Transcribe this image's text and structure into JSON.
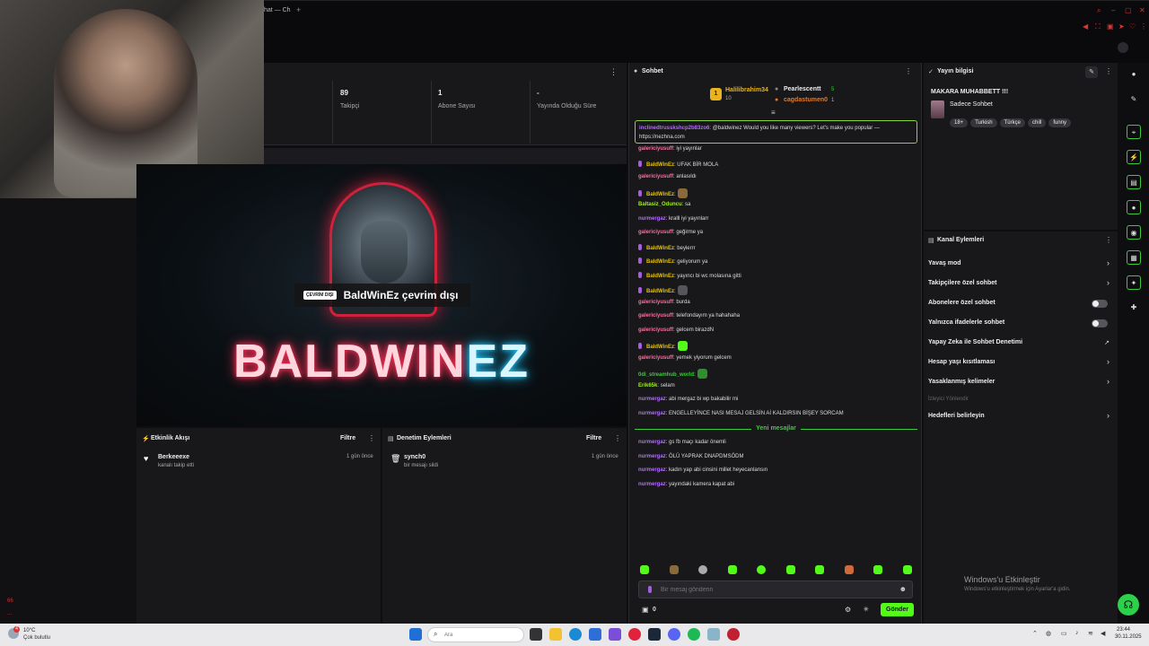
{
  "browser": {
    "tab_title": "hat — Ch",
    "new_tab": "+"
  },
  "stats": {
    "followers_value": "89",
    "followers_label": "Takipçi",
    "subs_value": "1",
    "subs_label": "Abone Sayısı",
    "live_value": "-",
    "live_label": "Yayında Olduğu Süre"
  },
  "video": {
    "offline_badge": "ÇEVRİM DIŞI",
    "offline_text": "BaldWinEz çevrim dışı",
    "brand_part1": "BALDWIN",
    "brand_part2": "EZ"
  },
  "activity": {
    "title": "Etkinlik Akışı",
    "filter": "Filtre",
    "items": [
      {
        "name": "Berkeeexe",
        "desc": "kanalı takip etti",
        "time": "1 gün önce"
      }
    ]
  },
  "moderation": {
    "title": "Denetim Eylemleri",
    "filter": "Filtre",
    "items": [
      {
        "name": "synch0",
        "desc": "bir mesajı sildi",
        "time": "1 gün önce"
      }
    ]
  },
  "chat": {
    "title": "Sohbet",
    "top_chatters": [
      {
        "rank": "1",
        "name": "Halilibrahim34",
        "sub": "10"
      },
      {
        "name": "Pearlescentt",
        "sub": "5"
      },
      {
        "name": "cagdastumen0",
        "sub": "1"
      }
    ],
    "pinned_user": "inclinedtrusskshcp2b83zo6",
    "pinned_text": ": @baldwinez Would you like many viewers? Let's make you popular — https://nezhna.com",
    "messages": [
      {
        "user": "galericiyusuff",
        "text": ": iyi yayınlar",
        "color": "#ff6b9a",
        "mic": false
      },
      {
        "user": "BaldWinEz",
        "text": ": UFAK BİR MOLA",
        "color": "#e5c100",
        "mic": true
      },
      {
        "user": "galericiyusuff",
        "text": ": anlasıldı",
        "color": "#ff6b9a",
        "mic": false
      },
      {
        "user": "BaldWinEz",
        "text": ":",
        "color": "#e5c100",
        "mic": true,
        "emote": "#8a6a3a"
      },
      {
        "user": "Baltasiz_Oduncu",
        "text": ": sa",
        "color": "#9ef01a",
        "mic": false
      },
      {
        "user": "nurmergaz",
        "text": ": kralll iyi yayınlarr",
        "color": "#b46bff",
        "mic": false
      },
      {
        "user": "galericiyusuff",
        "text": ": geğirme ya",
        "color": "#ff6b9a",
        "mic": false
      },
      {
        "user": "BaldWinEz",
        "text": ": beylerrr",
        "color": "#e5c100",
        "mic": true
      },
      {
        "user": "BaldWinEz",
        "text": ": geliyorum ya",
        "color": "#e5c100",
        "mic": true
      },
      {
        "user": "BaldWinEz",
        "text": ": yayıncı bi wc molasına gitti",
        "color": "#e5c100",
        "mic": true
      },
      {
        "user": "BaldWinEz",
        "text": ":",
        "color": "#e5c100",
        "mic": true,
        "emote": "#55555b"
      },
      {
        "user": "galericiyusuff",
        "text": ": burda",
        "color": "#ff6b9a",
        "mic": false
      },
      {
        "user": "galericiyusuff",
        "text": ": telefondayım ya hahahaha",
        "color": "#ff6b9a",
        "mic": false
      },
      {
        "user": "galericiyusuff",
        "text": ": gelcem birazdN",
        "color": "#ff6b9a",
        "mic": false
      },
      {
        "user": "BaldWinEz",
        "text": ":",
        "color": "#e5c100",
        "mic": true,
        "emote": "#53fc18"
      },
      {
        "user": "galericiyusuff",
        "text": ": yemek yiyorum gelcem",
        "color": "#ff6b9a",
        "mic": false
      },
      {
        "user": "0di_streamhub_world",
        "text": ":",
        "color": "#3ec93e",
        "mic": false,
        "emote": "#2f8f2f"
      },
      {
        "user": "Erik65k",
        "text": ": selam",
        "color": "#9ef01a",
        "mic": false
      },
      {
        "user": "nurmergaz",
        "text": ": abi mergaz bi wp bakabilir mi",
        "color": "#b46bff",
        "mic": false
      },
      {
        "user": "nurmergaz",
        "text": ": ENGELLEYİNCE NASI MESAJ GELSİN Aİ KALDIRSIN BİŞEY SORCAM",
        "color": "#b46bff",
        "mic": false
      }
    ],
    "new_messages_label": "Yeni mesajlar",
    "new_messages": [
      {
        "user": "nurmergaz",
        "text": ": gs fb maçı kadar önemli",
        "color": "#b46bff"
      },
      {
        "user": "nurmergaz",
        "text": ": ÖLÜ YAPRAK DNAPDMSÖDM",
        "color": "#b46bff"
      },
      {
        "user": "nurmergaz",
        "text": ": kadın yap abi cinsini millet heyecanlansın",
        "color": "#b46bff"
      },
      {
        "user": "nurmergaz",
        "text": ": yayındaki kamera kapat abi",
        "color": "#b46bff"
      }
    ],
    "input_placeholder": "Bir mesaj gönderin",
    "points": "0",
    "send_label": "Gönder"
  },
  "stream_info": {
    "title": "Yayın bilgisi",
    "stream_title": "MAKARA MUHABBETT !!!",
    "category": "Sadece Sohbet",
    "tags": [
      "18+",
      "Turkish",
      "Türkçe",
      "chill",
      "funny"
    ]
  },
  "channel_actions": {
    "title": "Kanal Eylemleri",
    "rows": [
      {
        "label": "Yavaş mod",
        "type": "chevron"
      },
      {
        "label": "Takipçilere özel sohbet",
        "type": "chevron"
      },
      {
        "label": "Abonelere özel sohbet",
        "type": "toggle"
      },
      {
        "label": "Yalnızca ifadelerle sohbet",
        "type": "toggle"
      },
      {
        "label": "Yapay Zeka ile Sohbet Denetimi",
        "type": "external"
      },
      {
        "label": "Hesap yaşı kısıtlaması",
        "type": "chevron"
      },
      {
        "label": "Yasaklanmış kelimeler",
        "type": "chevron"
      }
    ],
    "disabled_label": "İzleyici Yönlendir",
    "last_row": "Hedefleri belirleyin"
  },
  "windows": {
    "activate_title": "Windows'u Etkinleştir",
    "activate_sub": "Windows'u etkinleştirmek için Ayarlar'a gidin."
  },
  "taskbar": {
    "temperature": "10°C",
    "weather": "Çok bulutlu",
    "notification_count": "4",
    "search_placeholder": "Ara",
    "time": "23:44",
    "date": "30.11.2025"
  },
  "sidebar": {
    "marks": [
      "66",
      "..."
    ]
  },
  "colors": {
    "accent_green": "#53fc18",
    "panel_bg": "#18181b",
    "new_msg_green": "#3ec93e"
  }
}
